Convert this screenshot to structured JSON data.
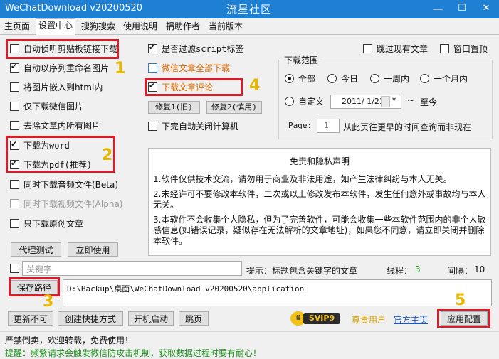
{
  "window": {
    "title": "WeChatDownload v20200520",
    "brand": "流星社区",
    "minimize_glyph": "—",
    "maximize_glyph": "☐",
    "close_glyph": "✕"
  },
  "tabs": [
    "主页面",
    "设置中心",
    "搜狗搜索",
    "使用说明",
    "捐助作者",
    "当前版本"
  ],
  "left_options": {
    "auto_clipboard": "自动侦听剪贴板链接下载",
    "auto_rename": "自动以序列重命名图片",
    "embed_images": "将图片嵌入到html内",
    "only_images": "仅下载微信图片",
    "remove_images": "去除文章内所有图片",
    "as_word": "下载为word",
    "as_pdf": "下载为pdf(推荐)",
    "audio": "同时下载音频文件(Beta)",
    "video": "同时下载视频文件(Alpha)",
    "original_only": "只下载原创文章"
  },
  "buttons": {
    "proxy_test": "代理测试",
    "use_now": "立即使用",
    "fix1": "修复1(旧)",
    "fix2": "修复2(慎用)",
    "save_path": "保存路径",
    "update": "更新不可",
    "create_shortcut": "创建快捷方式",
    "startup": "开机启动",
    "jump": "跳页",
    "apply": "应用配置"
  },
  "middle_options": {
    "filter_script": "是否过滤script标签",
    "download_all": "微信文章全部下载",
    "download_comments": "下载文章评论",
    "shutdown": "下完自动关闭计算机"
  },
  "top_right": {
    "skip_existing": "跳过现有文章",
    "pin_window": "窗口置顶"
  },
  "range": {
    "label": "下载范围",
    "all": "全部",
    "today": "今日",
    "week": "一周内",
    "month": "一个月内",
    "custom": "自定义",
    "date_value": "2011/ 1/21",
    "until": "至今",
    "page_label": "Page:",
    "page_value": "1",
    "page_hint": "从此页往更早的时间查询而非现在"
  },
  "disclaimer": {
    "title": "免责和隐私声明",
    "p1": "1.软件仅供技术交流，请勿用于商业及非法用途，如产生法律纠纷与本人无关。",
    "p2": "2.未经许可不要修改本软件，二次或以上修改发布本软件，发生任何意外或事故均与本人无关。",
    "p3": "3.本软件不会收集个人隐私，但为了完善软件，可能会收集一些本软件范围内的非个人敏感信息(如错误记录，疑似存在无法解析的文章地址)，如果您不同意，请立即关闭并删除本软件。"
  },
  "keyword": {
    "placeholder": "关键字",
    "hint": "提示：标题包含关键字的文章",
    "threads_label": "线程：",
    "threads_value": "3",
    "interval_label": "间隔：",
    "interval_value": "10"
  },
  "save_path_value": "D:\\Backup\\桌面\\WeChatDownload v20200520\\application",
  "badge": {
    "text": "SVIP9"
  },
  "links": {
    "paid_user": "尊贵用户",
    "official_site": "官方主页"
  },
  "annotations": [
    "1",
    "2",
    "3",
    "4",
    "5"
  ],
  "status": {
    "line1": "严禁倒卖，欢迎转载，免费使用！",
    "line2": "提醒：频繁请求会触发微信防攻击机制，获取数据过程时要有耐心！"
  },
  "colors": {
    "titlebar": "#1f7fd3",
    "annotation_red": "#d51d2c",
    "annotation_yellow": "#e8b800",
    "orange_text": "#e06a00",
    "status_green": "#1a8f1a",
    "link_blue": "#1a55c2",
    "green_value": "#1a8f1a"
  }
}
